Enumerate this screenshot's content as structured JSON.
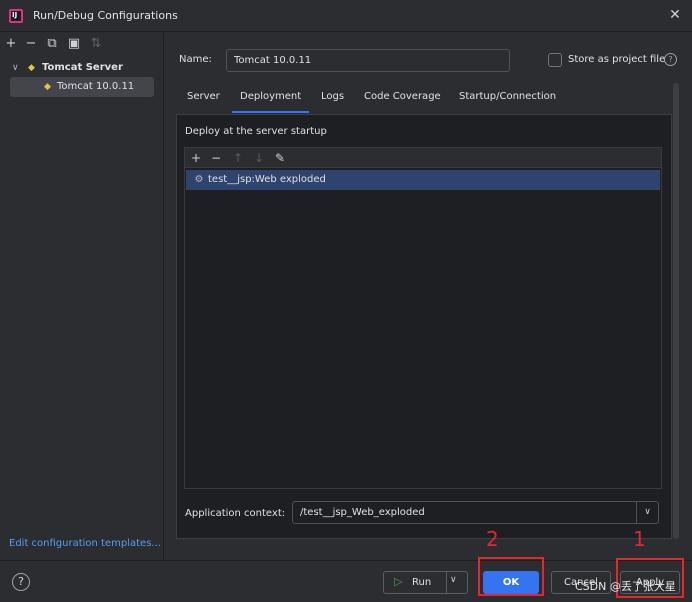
{
  "window": {
    "title": "Run/Debug Configurations"
  },
  "tree": {
    "group": "Tomcat Server",
    "item": "Tomcat 10.0.11"
  },
  "edit_templates": "Edit configuration templates...",
  "form": {
    "name_label": "Name:",
    "name_value": "Tomcat 10.0.11",
    "store_label": "Store as project file",
    "store_checked": false
  },
  "tabs": [
    "Server",
    "Deployment",
    "Logs",
    "Code Coverage",
    "Startup/Connection"
  ],
  "active_tab": "Deployment",
  "deployment": {
    "section_label": "Deploy at the server startup",
    "artifacts": [
      "test__jsp:Web exploded"
    ],
    "app_context_label": "Application context:",
    "app_context_value": "/test__jsp_Web_exploded"
  },
  "buttons": {
    "run": "Run",
    "ok": "OK",
    "cancel": "Cancel",
    "apply": "Apply"
  },
  "annotations": [
    "1",
    "2"
  ],
  "watermark": "CSDN @丢了张大星",
  "colors": {
    "accent": "#3574f0",
    "annotation": "#e5262b",
    "link": "#589df6",
    "selection": "#2e436e"
  }
}
